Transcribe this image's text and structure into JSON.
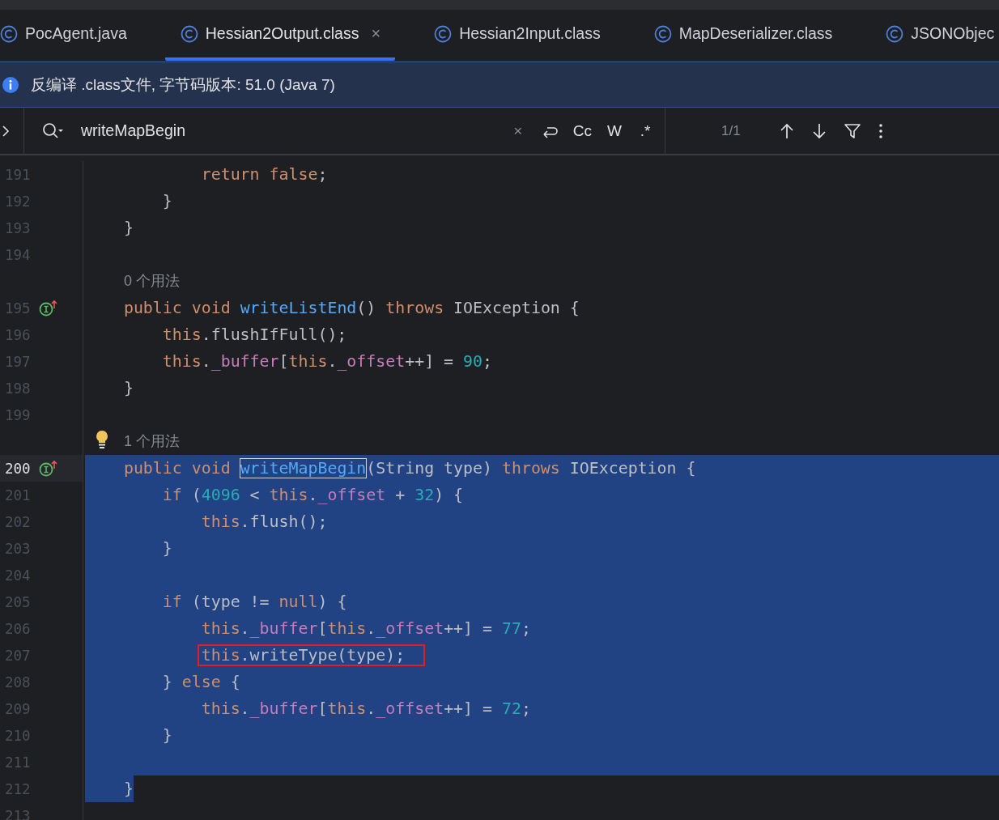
{
  "tabs": [
    {
      "label": "PocAgent.java",
      "selected": false
    },
    {
      "label": "Hessian2Output.class",
      "selected": true,
      "close": "×"
    },
    {
      "label": "Hessian2Input.class",
      "selected": false
    },
    {
      "label": "MapDeserializer.class",
      "selected": false
    },
    {
      "label": "JSONObjec",
      "selected": false
    }
  ],
  "banner": {
    "text": "反编译 .class文件, 字节码版本: 51.0 (Java 7)"
  },
  "search": {
    "value": "writeMapBegin",
    "clear": "×",
    "options": [
      "Cc",
      "W",
      ".*"
    ],
    "count": "1/1"
  },
  "lines": [
    {
      "number": "191",
      "selected": false,
      "tokens": [
        {
          "kind": "keyword",
          "text": "            return"
        },
        {
          "kind": "keyword",
          "text": " false"
        },
        {
          "kind": "plain",
          "text": ";"
        }
      ]
    },
    {
      "number": "192",
      "selected": false,
      "tokens": [
        {
          "kind": "plain",
          "text": "        }"
        }
      ]
    },
    {
      "number": "193",
      "selected": false,
      "tokens": [
        {
          "kind": "plain",
          "text": "    }"
        }
      ]
    },
    {
      "number": "194",
      "selected": false
    },
    {
      "kind": "hint",
      "text": "0 个用法",
      "bulb": false
    },
    {
      "number": "195",
      "selected": false,
      "marker": true,
      "tokens": [
        {
          "kind": "keyword",
          "text": "    public"
        },
        {
          "kind": "keyword",
          "text": " void"
        },
        {
          "kind": "method",
          "text": " writeListEnd"
        },
        {
          "kind": "plain",
          "text": "() "
        },
        {
          "kind": "keyword",
          "text": "throws"
        },
        {
          "kind": "plain",
          "text": " IOException {"
        }
      ]
    },
    {
      "number": "196",
      "selected": false,
      "tokens": [
        {
          "kind": "keyword",
          "text": "        this"
        },
        {
          "kind": "plain",
          "text": ".flushIfFull();"
        }
      ]
    },
    {
      "number": "197",
      "selected": false,
      "tokens": [
        {
          "kind": "keyword",
          "text": "        this"
        },
        {
          "kind": "plain",
          "text": "."
        },
        {
          "kind": "field",
          "text": "_buffer"
        },
        {
          "kind": "plain",
          "text": "["
        },
        {
          "kind": "keyword",
          "text": "this"
        },
        {
          "kind": "plain",
          "text": "."
        },
        {
          "kind": "field",
          "text": "_offset"
        },
        {
          "kind": "plain",
          "text": "++] = "
        },
        {
          "kind": "number",
          "text": "90"
        },
        {
          "kind": "plain",
          "text": ";"
        }
      ]
    },
    {
      "number": "198",
      "selected": false,
      "tokens": [
        {
          "kind": "plain",
          "text": "    }"
        }
      ]
    },
    {
      "number": "199",
      "selected": false
    },
    {
      "kind": "hint",
      "text": "1 个用法",
      "bulb": true
    },
    {
      "number": "200",
      "selected": true,
      "current": true,
      "marker": true,
      "tokens": [
        {
          "kind": "keyword",
          "text": "    public"
        },
        {
          "kind": "keyword",
          "text": " void "
        },
        {
          "kind": "match",
          "text": "writeMapBegin"
        },
        {
          "kind": "plain",
          "text": "(String type) "
        },
        {
          "kind": "keyword",
          "text": "throws"
        },
        {
          "kind": "plain",
          "text": " IOException {"
        }
      ]
    },
    {
      "number": "201",
      "selected": true,
      "tokens": [
        {
          "kind": "keyword",
          "text": "        if"
        },
        {
          "kind": "plain",
          "text": " ("
        },
        {
          "kind": "number",
          "text": "4096"
        },
        {
          "kind": "plain",
          "text": " < "
        },
        {
          "kind": "keyword",
          "text": "this"
        },
        {
          "kind": "plain",
          "text": "."
        },
        {
          "kind": "field",
          "text": "_offset"
        },
        {
          "kind": "plain",
          "text": " + "
        },
        {
          "kind": "number",
          "text": "32"
        },
        {
          "kind": "plain",
          "text": ") {"
        }
      ]
    },
    {
      "number": "202",
      "selected": true,
      "tokens": [
        {
          "kind": "keyword",
          "text": "            this"
        },
        {
          "kind": "plain",
          "text": ".flush();"
        }
      ]
    },
    {
      "number": "203",
      "selected": true,
      "tokens": [
        {
          "kind": "plain",
          "text": "        }"
        }
      ]
    },
    {
      "number": "204",
      "selected": true
    },
    {
      "number": "205",
      "selected": true,
      "tokens": [
        {
          "kind": "keyword",
          "text": "        if"
        },
        {
          "kind": "plain",
          "text": " (type != "
        },
        {
          "kind": "keyword",
          "text": "null"
        },
        {
          "kind": "plain",
          "text": ") {"
        }
      ]
    },
    {
      "number": "206",
      "selected": true,
      "tokens": [
        {
          "kind": "keyword",
          "text": "            this"
        },
        {
          "kind": "plain",
          "text": "."
        },
        {
          "kind": "field",
          "text": "_buffer"
        },
        {
          "kind": "plain",
          "text": "["
        },
        {
          "kind": "keyword",
          "text": "this"
        },
        {
          "kind": "plain",
          "text": "."
        },
        {
          "kind": "field",
          "text": "_offset"
        },
        {
          "kind": "plain",
          "text": "++] = "
        },
        {
          "kind": "number",
          "text": "77"
        },
        {
          "kind": "plain",
          "text": ";"
        }
      ]
    },
    {
      "number": "207",
      "selected": true,
      "annotated": true,
      "tokens": [
        {
          "kind": "keyword",
          "text": "            this"
        },
        {
          "kind": "plain",
          "text": ".writeType(type);"
        }
      ]
    },
    {
      "number": "208",
      "selected": true,
      "tokens": [
        {
          "kind": "plain",
          "text": "        } "
        },
        {
          "kind": "keyword",
          "text": "else"
        },
        {
          "kind": "plain",
          "text": " {"
        }
      ]
    },
    {
      "number": "209",
      "selected": true,
      "tokens": [
        {
          "kind": "keyword",
          "text": "            this"
        },
        {
          "kind": "plain",
          "text": "."
        },
        {
          "kind": "field",
          "text": "_buffer"
        },
        {
          "kind": "plain",
          "text": "["
        },
        {
          "kind": "keyword",
          "text": "this"
        },
        {
          "kind": "plain",
          "text": "."
        },
        {
          "kind": "field",
          "text": "_offset"
        },
        {
          "kind": "plain",
          "text": "++] = "
        },
        {
          "kind": "number",
          "text": "72"
        },
        {
          "kind": "plain",
          "text": ";"
        }
      ]
    },
    {
      "number": "210",
      "selected": true,
      "tokens": [
        {
          "kind": "plain",
          "text": "        }"
        }
      ]
    },
    {
      "number": "211",
      "selected": true
    },
    {
      "number": "212",
      "selected": true,
      "selection_end": true,
      "tokens": [
        {
          "kind": "plain",
          "text": "    }"
        }
      ]
    },
    {
      "number": "213",
      "selected": false
    }
  ]
}
